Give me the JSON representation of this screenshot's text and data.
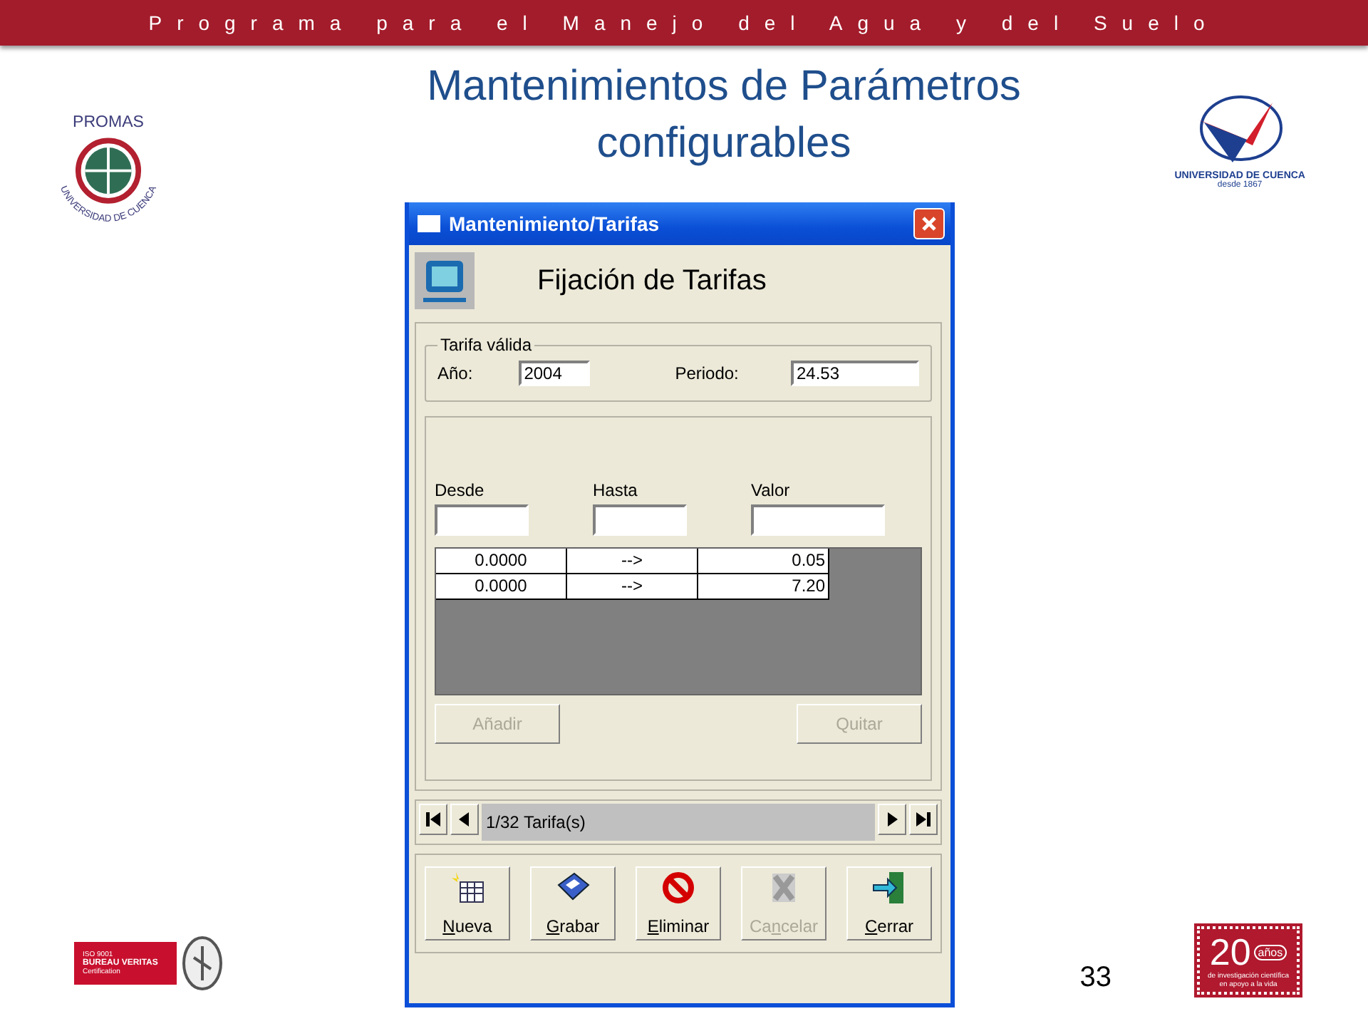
{
  "header": {
    "text": "Programa para el Manejo del Agua y del Suelo"
  },
  "title_lines": [
    "Mantenimientos de Parámetros",
    "configurables"
  ],
  "logos": {
    "promas": {
      "name": "PROMAS",
      "ring_text": "UNIVERSIDAD DE CUENCA"
    },
    "university": {
      "name": "UNIVERSIDAD DE CUENCA",
      "since": "desde 1867"
    },
    "certification": {
      "standard": "ISO 9001",
      "name": "BUREAU VERITAS",
      "subtitle": "Certification"
    },
    "anniversary": {
      "number": "20",
      "unit": "años",
      "tagline_lines": [
        "de investigación científica",
        "en apoyo a la vida"
      ]
    }
  },
  "window": {
    "title": "Mantenimiento/Tarifas",
    "heading": "Fijación de Tarifas",
    "group": {
      "title": "Tarifa válida",
      "fields": [
        {
          "label": "Año:",
          "value": "2004"
        },
        {
          "label": "Periodo:",
          "value": "24.53"
        }
      ]
    },
    "range_fields": [
      {
        "label": "Desde"
      },
      {
        "label": "Hasta"
      },
      {
        "label": "Valor"
      }
    ],
    "grid_rows": [
      [
        "0.0000",
        "-->",
        "0.05"
      ],
      [
        "0.0000",
        "-->",
        "7.20"
      ]
    ],
    "grid_buttons": [
      {
        "label": "Añadir",
        "disabled": true
      },
      {
        "label": "Quitar",
        "disabled": true
      }
    ],
    "navigator": {
      "text": "1/32 Tarifa(s)"
    },
    "toolbar": [
      {
        "kind": "new",
        "label": "Nueva",
        "disabled": false
      },
      {
        "kind": "save",
        "label": "Grabar",
        "disabled": false
      },
      {
        "kind": "delete",
        "label": "Eliminar",
        "disabled": false
      },
      {
        "kind": "cancel",
        "label": "Cancelar",
        "disabled": true
      },
      {
        "kind": "close",
        "label": "Cerrar",
        "disabled": false
      }
    ]
  },
  "slide_number": "33"
}
